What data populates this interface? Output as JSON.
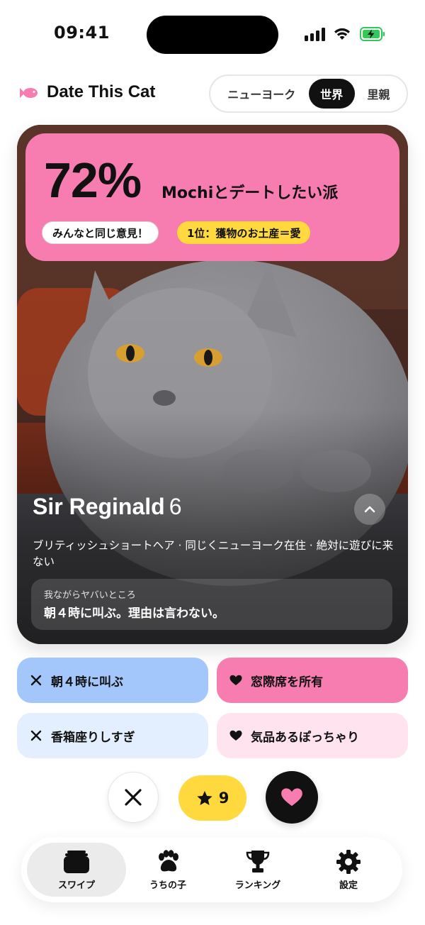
{
  "status_bar": {
    "time": "09:41"
  },
  "header": {
    "title": "Date This Cat",
    "segments": [
      {
        "label": "ニューヨーク",
        "selected": false
      },
      {
        "label": "世界",
        "selected": true
      },
      {
        "label": "里親",
        "selected": false
      }
    ]
  },
  "card": {
    "poll": {
      "percent": "72%",
      "text": "Mochiとデートしたい派",
      "badge_agree": "みんなと同じ意見！",
      "badge_rank": "1位：獲物のお土産＝愛"
    },
    "cat": {
      "name": "Sir Reginald",
      "age": "6",
      "description": "ブリティッシュショートヘア · 同じくニューヨーク在住 · 絶対に遊びに来ない",
      "quirk_label": "我ながらヤバいところ",
      "quirk_text": "朝４時に叫ぶ。理由は言わない。"
    }
  },
  "traits": [
    {
      "icon": "x-icon",
      "label": "朝４時に叫ぶ",
      "kind": "negative"
    },
    {
      "icon": "heart-icon",
      "label": "窓際席を所有",
      "kind": "positive"
    },
    {
      "icon": "x-icon",
      "label": "香箱座りしすぎ",
      "kind": "negative"
    },
    {
      "icon": "heart-icon",
      "label": "気品あるぽっちゃり",
      "kind": "positive"
    }
  ],
  "actions": {
    "super_like_count": "9"
  },
  "tabbar": {
    "tabs": [
      {
        "label": "スワイプ",
        "icon": "cards-icon",
        "active": true
      },
      {
        "label": "うちの子",
        "icon": "paw-icon",
        "active": false
      },
      {
        "label": "ランキング",
        "icon": "trophy-icon",
        "active": false
      },
      {
        "label": "設定",
        "icon": "gear-icon",
        "active": false
      }
    ]
  },
  "colors": {
    "pink": "#f77caf",
    "yellow": "#ffd93d",
    "blue": "#a3c6fb",
    "light_blue": "#e3efff",
    "light_pink": "#ffe3ee",
    "dark": "#111111"
  }
}
